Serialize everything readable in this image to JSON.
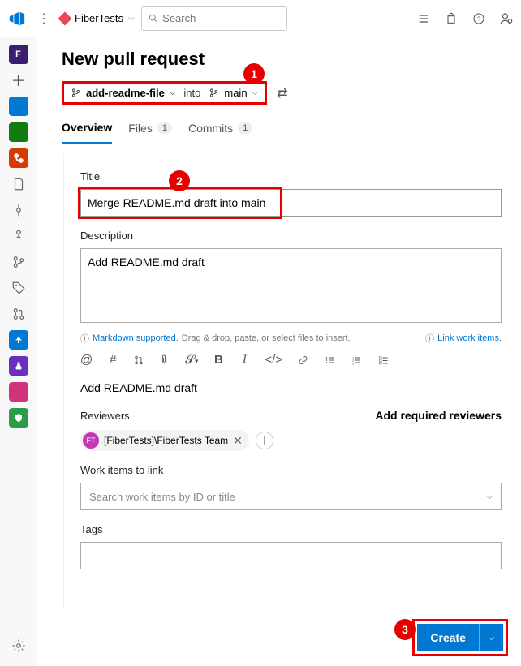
{
  "top": {
    "project": "FiberTests",
    "searchPlaceholder": "Search"
  },
  "page": {
    "heading": "New pull request",
    "sourceBranch": "add-readme-file",
    "into": "into",
    "targetBranch": "main"
  },
  "callouts": {
    "c1": "1",
    "c2": "2",
    "c3": "3"
  },
  "tabs": {
    "overview": "Overview",
    "files": "Files",
    "filesCount": "1",
    "commits": "Commits",
    "commitsCount": "1"
  },
  "form": {
    "titleLabel": "Title",
    "titleValue": "Merge README.md draft into main",
    "descLabel": "Description",
    "descValue": "Add README.md draft",
    "mdSupported": "Markdown supported.",
    "mdHint": "Drag & drop, paste, or select files to insert.",
    "linkWork": "Link work items.",
    "preview": "Add README.md draft",
    "reviewersLabel": "Reviewers",
    "addRequired": "Add required reviewers",
    "chipAv": "FT",
    "chipText": "[FiberTests]\\FiberTests Team",
    "workLabel": "Work items to link",
    "workPlaceholder": "Search work items by ID or title",
    "tagsLabel": "Tags",
    "createLabel": "Create"
  }
}
